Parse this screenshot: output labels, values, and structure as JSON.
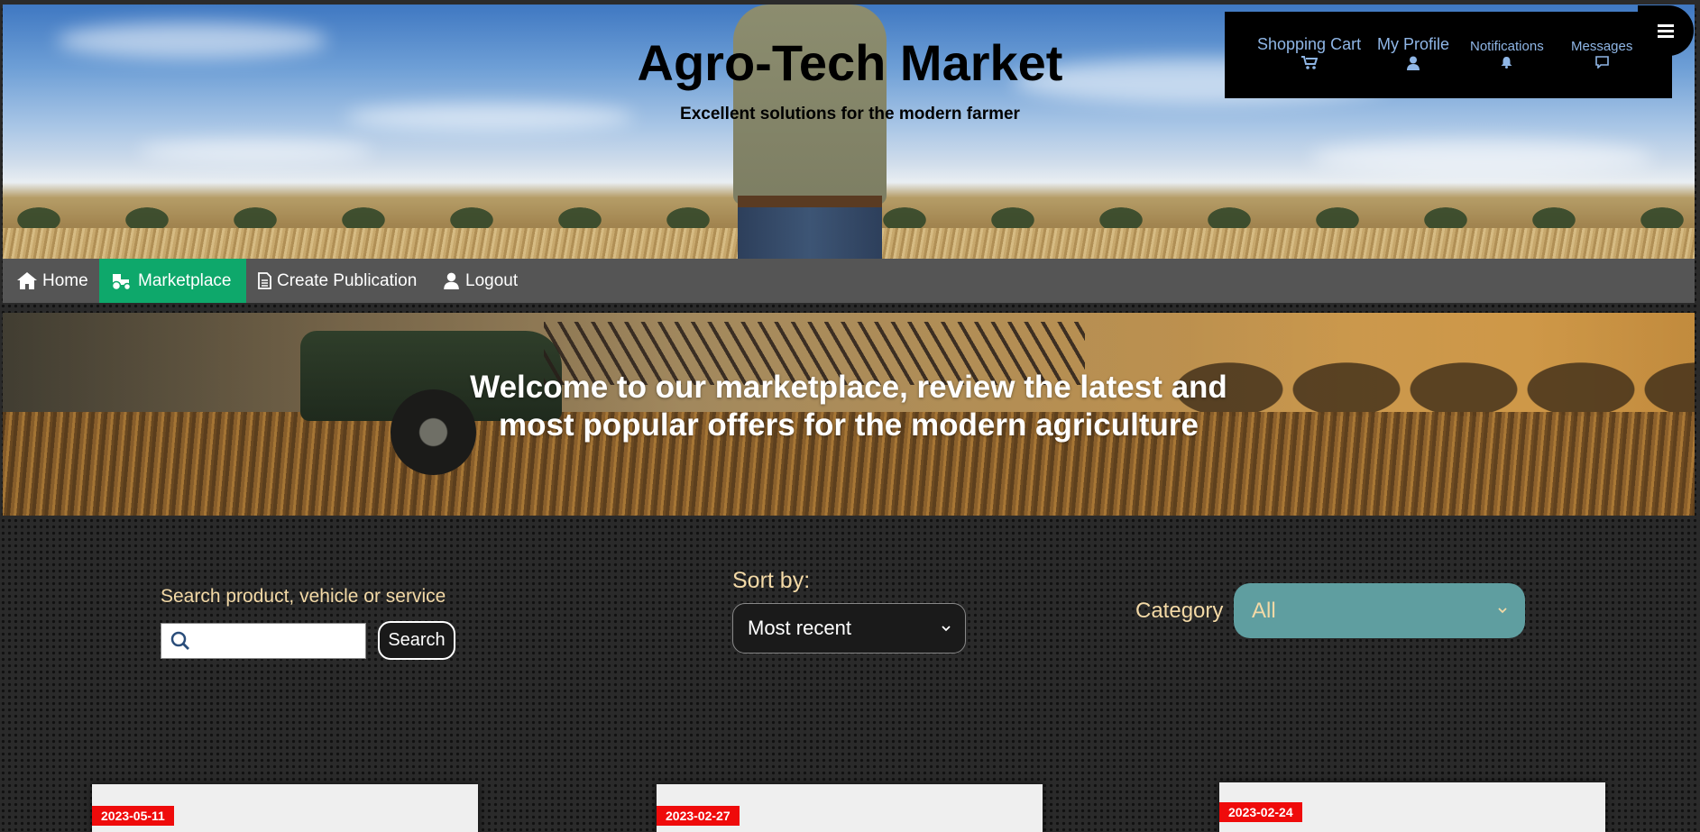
{
  "header": {
    "title": "Agro-Tech Market",
    "subtitle": "Excellent solutions for the modern farmer"
  },
  "topnav": {
    "items": [
      {
        "label": "Shopping Cart",
        "icon": "cart-icon"
      },
      {
        "label": "My Profile",
        "icon": "user-icon"
      },
      {
        "label": "Notifications",
        "icon": "bell-icon"
      },
      {
        "label": "Messages",
        "icon": "chat-icon"
      }
    ],
    "menu_icon": "hamburger-icon"
  },
  "navbar": {
    "items": [
      {
        "label": "Home",
        "icon": "home-icon",
        "active": false
      },
      {
        "label": "Marketplace",
        "icon": "tractor-icon",
        "active": true
      },
      {
        "label": "Create Publication",
        "icon": "document-icon",
        "active": false
      },
      {
        "label": "Logout",
        "icon": "user-icon",
        "active": false
      }
    ],
    "active_color": "#0ea86b"
  },
  "banner": {
    "welcome_line1": "Welcome to our marketplace, review the latest and",
    "welcome_line2": "most popular offers for the modern agriculture"
  },
  "filters": {
    "search_label": "Search product, vehicle or service",
    "search_value": "",
    "search_button": "Search",
    "sort_label": "Sort by:",
    "sort_selected": "Most recent",
    "category_label": "Category",
    "category_selected": "All",
    "category_color": "#5f9ea0",
    "label_color": "#f3d9a6"
  },
  "cards": [
    {
      "date": "2023-05-11"
    },
    {
      "date": "2023-02-27"
    },
    {
      "date": "2023-02-24"
    }
  ],
  "badge_color": "#ef0b0b"
}
